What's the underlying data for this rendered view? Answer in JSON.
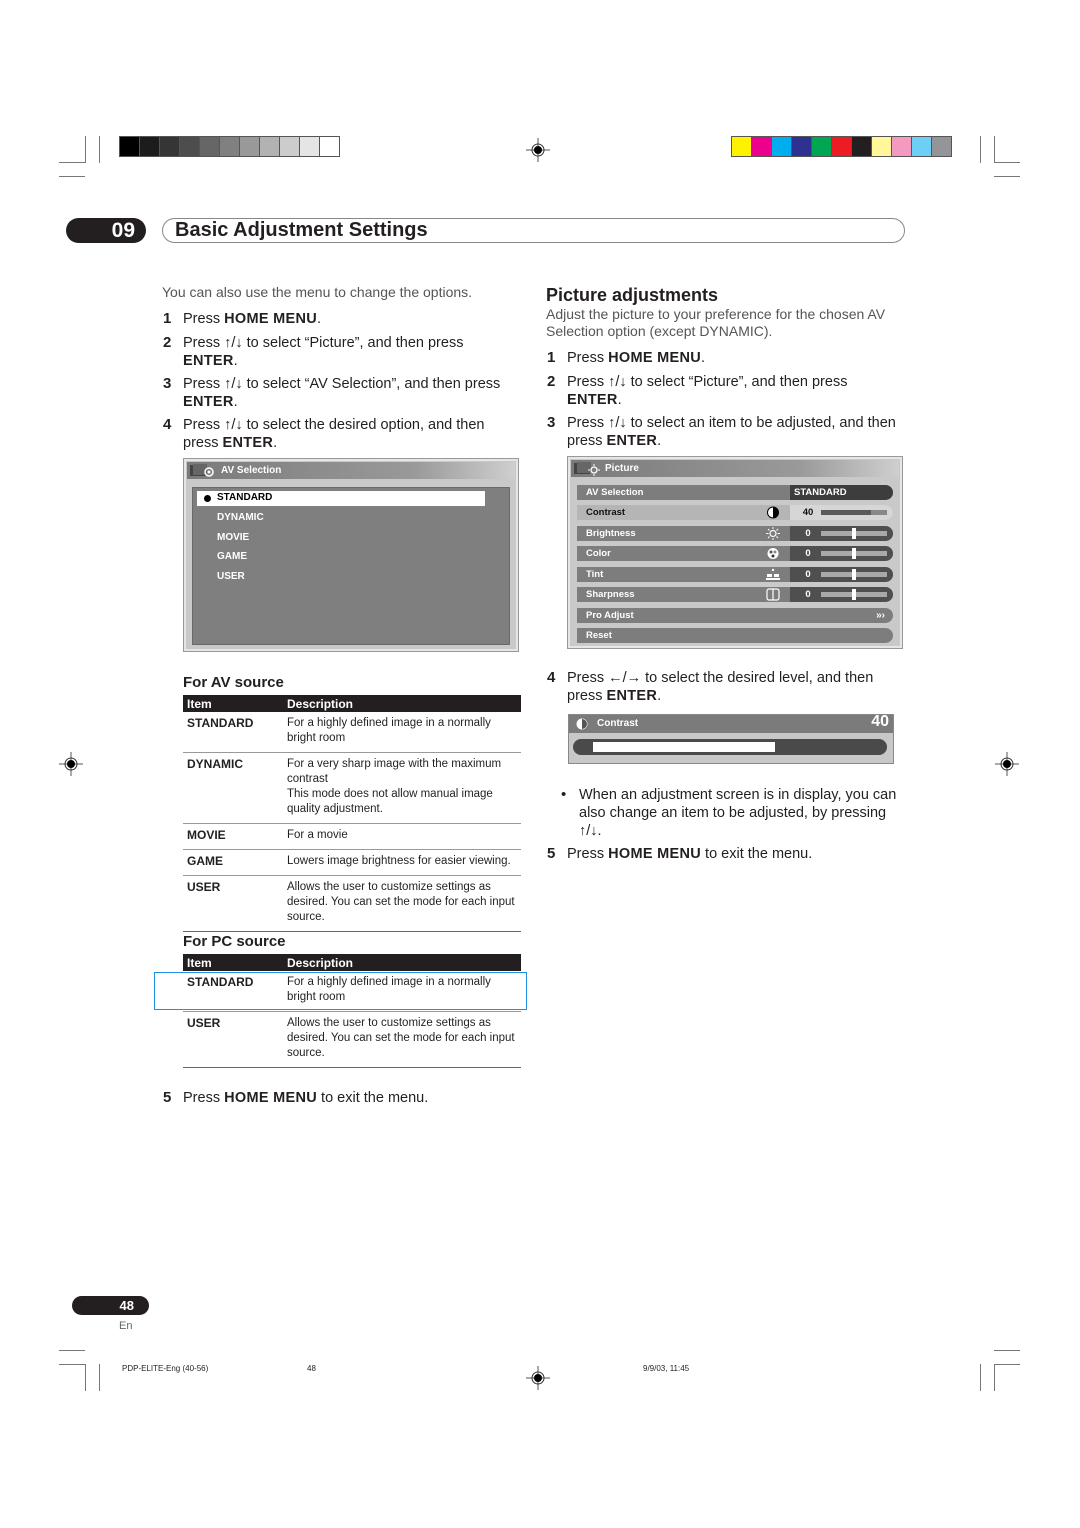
{
  "print_marks": {
    "gray_bar": [
      "#000000",
      "#1c1c1c",
      "#353535",
      "#4d4d4d",
      "#666666",
      "#808080",
      "#999999",
      "#b2b2b2",
      "#cccccc",
      "#e5e5e5",
      "#ffffff"
    ],
    "color_bar": [
      "#fff200",
      "#ec008c",
      "#00aeef",
      "#2e3192",
      "#00a651",
      "#ed1c24",
      "#231f20",
      "#fff799",
      "#f49ac1",
      "#6dcff6",
      "#939598"
    ]
  },
  "header": {
    "chapter_number": "09",
    "chapter_title": "Basic Adjustment Settings"
  },
  "left": {
    "intro": "You can also use the menu to change the options.",
    "steps": [
      {
        "num": "1",
        "pre": "Press ",
        "bold": "HOME MENU",
        "post": "."
      },
      {
        "num": "2",
        "pre": "Press ↑/↓ to select “Picture”, and then press",
        "bold": "ENTER",
        "post": "."
      },
      {
        "num": "3",
        "pre": "Press ↑/↓ to select “AV Selection”, and then press",
        "bold": "ENTER",
        "post": "."
      },
      {
        "num": "4",
        "pre": "Press ↑/↓ to select the desired option, and then press ",
        "bold": "ENTER",
        "post": "."
      }
    ],
    "av_selection_osd": {
      "title": "AV Selection",
      "selected": "STANDARD",
      "options": [
        "DYNAMIC",
        "MOVIE",
        "GAME",
        "USER"
      ]
    },
    "av_source": {
      "heading": "For AV source",
      "columns": [
        "Item",
        "Description"
      ],
      "rows": [
        {
          "item": "STANDARD",
          "desc": "For a highly defined image in a normally bright room"
        },
        {
          "item": "DYNAMIC",
          "desc": "For a very sharp image with the maximum contrast",
          "desc2": "This mode does not allow manual image quality adjustment."
        },
        {
          "item": "MOVIE",
          "desc": "For a movie"
        },
        {
          "item": "GAME",
          "desc": "Lowers image brightness for easier viewing."
        },
        {
          "item": "USER",
          "desc": "Allows the user to customize settings as desired. You can set the mode for each input source."
        }
      ]
    },
    "pc_source": {
      "heading": "For PC source",
      "columns": [
        "Item",
        "Description"
      ],
      "rows": [
        {
          "item": "STANDARD",
          "desc": "For a highly defined image in a normally bright room"
        },
        {
          "item": "USER",
          "desc": "Allows the user to customize settings as desired. You can set the mode for each input source."
        }
      ]
    },
    "step5": {
      "num": "5",
      "pre": "Press ",
      "bold": "HOME MENU",
      "post": " to exit the menu."
    }
  },
  "right": {
    "heading": "Picture adjustments",
    "intro": "Adjust the picture to your preference for the chosen AV Selection option (except DYNAMIC).",
    "steps": [
      {
        "num": "1",
        "pre": "Press ",
        "bold": "HOME MENU",
        "post": "."
      },
      {
        "num": "2",
        "pre": "Press ↑/↓ to select “Picture”, and then press",
        "bold": "ENTER",
        "post": "."
      },
      {
        "num": "3",
        "pre": "Press ↑/↓ to select an item to be adjusted, and then press ",
        "bold": "ENTER",
        "post": "."
      }
    ],
    "picture_osd": {
      "title": "Picture",
      "av_selection": {
        "label": "AV Selection",
        "value": "STANDARD"
      },
      "items": [
        {
          "label": "Contrast",
          "icon": "contrast-icon",
          "value": "40",
          "level": 0.75,
          "selected": true
        },
        {
          "label": "Brightness",
          "icon": "brightness-icon",
          "value": "0",
          "level": 0.5
        },
        {
          "label": "Color",
          "icon": "color-icon",
          "value": "0",
          "level": 0.5
        },
        {
          "label": "Tint",
          "icon": "tint-icon",
          "value": "0",
          "level": 0.5
        },
        {
          "label": "Sharpness",
          "icon": "sharpness-icon",
          "value": "0",
          "level": 0.5
        }
      ],
      "pro_adjust": {
        "label": "Pro Adjust",
        "arrow": "»›"
      },
      "reset": {
        "label": "Reset"
      }
    },
    "step4": {
      "num": "4",
      "pre": "Press ←/→ to select the desired level, and then press ",
      "bold": "ENTER",
      "post": "."
    },
    "level_osd": {
      "label": "Contrast",
      "value": "40",
      "level": 0.6
    },
    "note": "When an adjustment screen is in display, you can also change an item to be adjusted, by pressing ↑/↓.",
    "step5": {
      "num": "5",
      "pre": "Press ",
      "bold": "HOME MENU",
      "post": " to exit the menu."
    }
  },
  "page": {
    "number": "48",
    "lang": "En"
  },
  "footer": {
    "file": "PDP-ELITE-Eng (40-56)",
    "page": "48",
    "datetime": "9/9/03, 11:45"
  }
}
